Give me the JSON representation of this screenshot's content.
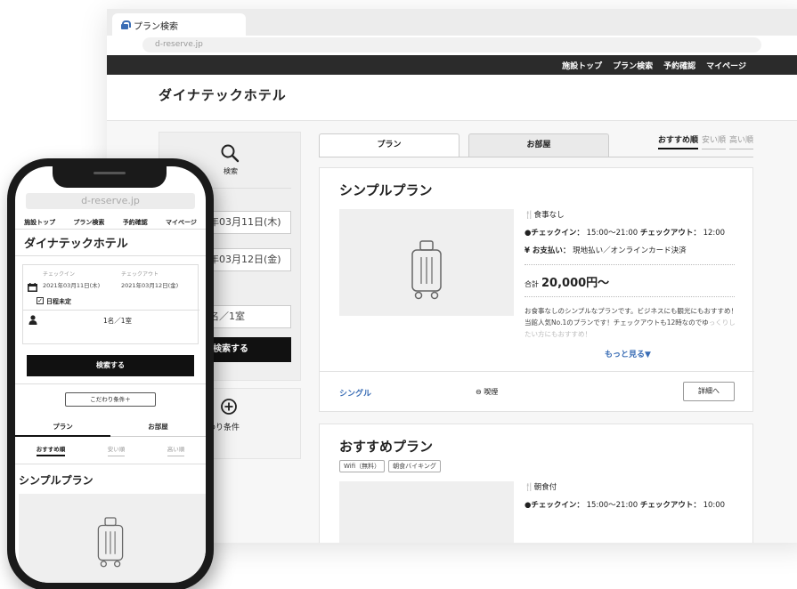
{
  "browser": {
    "tab_title": "プラン検索",
    "url": "d-reserve.jp"
  },
  "nav": {
    "items": [
      "施設トップ",
      "プラン検索",
      "予約確認",
      "マイページ"
    ]
  },
  "hotel": {
    "name": "ダイナテックホテル"
  },
  "search_panel": {
    "label": "検索",
    "checkin_value": "年03月11日(木)",
    "checkout_value": "年03月12日(金)",
    "guests_value": "名／1室",
    "search_button": "検索する",
    "filter_label": "だわり条件"
  },
  "tabs": {
    "plan": "プラン",
    "room": "お部屋"
  },
  "sort": {
    "recommended": "おすすめ順",
    "cheap": "安い順",
    "expensive": "高い順"
  },
  "plans": [
    {
      "title": "シンプルプラン",
      "meal": "食事なし",
      "checkin": "チェックイン：",
      "checkin_time": "15:00〜21:00",
      "checkout": "チェックアウト：",
      "checkout_time": "12:00",
      "payment_label": "お支払い：",
      "payment_value": "現地払い／オンラインカード決済",
      "total_label": "合計",
      "price": "20,000円〜",
      "description": "お食事なしのシンプルなプランです。ビジネスにも観光にもおすすめ！当館人気No.1のプランです！チェックアウトも12時なのでゆ",
      "description_fade": "っくりしたい方にもおすすめ！",
      "more": "もっと見る▼",
      "room_type": "シングル",
      "smoking": "喫煙",
      "detail_button": "詳細へ"
    },
    {
      "title": "おすすめプラン",
      "tags": [
        "Wifi（無料）",
        "朝食バイキング"
      ],
      "meal": "朝食付",
      "checkin": "チェックイン：",
      "checkin_time": "15:00〜21:00",
      "checkout": "チェックアウト：",
      "checkout_time": "10:00"
    }
  ],
  "mobile": {
    "url": "d-reserve.jp",
    "nav": [
      "施設トップ",
      "プラン検索",
      "予約確認",
      "マイページ"
    ],
    "hotel_name": "ダイナテックホテル",
    "checkin_label": "チェックイン",
    "checkin_value": "2021年03月11日(木)",
    "checkout_label": "チェックアウト",
    "checkout_value": "2021年03月12日(金)",
    "undecided": "日程未定",
    "guests": "1名／1室",
    "search_button": "検索する",
    "filter_button": "こだわり条件＋",
    "tab_plan": "プラン",
    "tab_room": "お部屋",
    "sort_recommended": "おすすめ順",
    "sort_cheap": "安い順",
    "sort_expensive": "高い順",
    "plan_title": "シンプルプラン"
  }
}
